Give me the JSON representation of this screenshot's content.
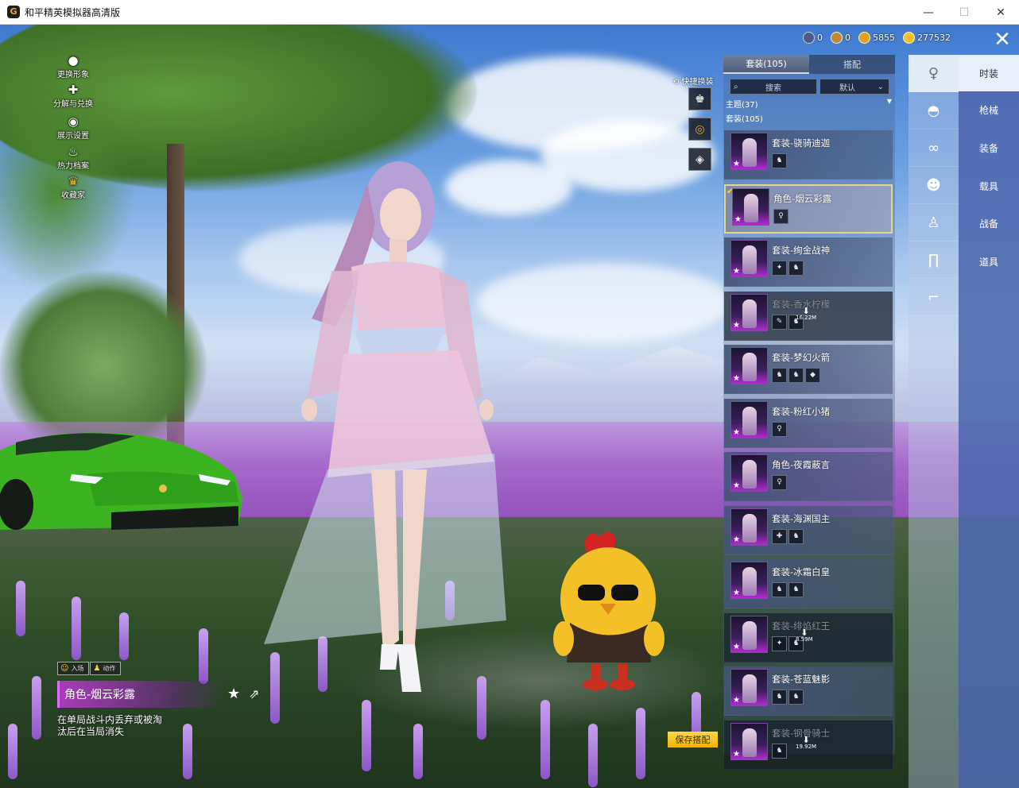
{
  "window": {
    "title": "和平精英模拟器高清版",
    "app_icon": "G",
    "minimize": "—",
    "maximize": "☐",
    "close": "✕"
  },
  "left_menu": [
    {
      "label": "更换形象",
      "icon": "person-icon"
    },
    {
      "label": "分解与兑换",
      "icon": "puzzle-icon"
    },
    {
      "label": "展示设置",
      "icon": "eye-icon"
    },
    {
      "label": "热力档案",
      "icon": "flame-icon"
    },
    {
      "label": "收藏家",
      "icon": "collector-badge-icon"
    }
  ],
  "currency": [
    {
      "name": "gem",
      "value": "0",
      "color": "#4a5a8a"
    },
    {
      "name": "token",
      "value": "0",
      "color": "#c08a30"
    },
    {
      "name": "coupon",
      "value": "5855",
      "color": "#e0a020"
    },
    {
      "name": "coin",
      "value": "277532",
      "color": "#f2c230"
    }
  ],
  "quick_change": {
    "label": "快捷换装"
  },
  "panel": {
    "tabs": [
      "套装(105)",
      "搭配"
    ],
    "search_placeholder": "搜索",
    "sort_value": "默认",
    "theme_label": "主题(37)",
    "set_label": "套装(105)"
  },
  "items": [
    {
      "name": "套装-骁骑迪迦",
      "minis": [
        "♞"
      ],
      "selected": false,
      "download": ""
    },
    {
      "name": "角色-烟云彩露",
      "minis": [
        "♀"
      ],
      "selected": true,
      "download": ""
    },
    {
      "name": "套装-绚金战神",
      "minis": [
        "✦",
        "♞"
      ],
      "selected": false,
      "download": ""
    },
    {
      "name": "套装-香水柠檬",
      "minis": [
        "✎",
        "♞"
      ],
      "selected": false,
      "download": "16.22M"
    },
    {
      "name": "套装-梦幻火箭",
      "minis": [
        "♞",
        "♞",
        "◆"
      ],
      "selected": false,
      "download": ""
    },
    {
      "name": "套装-粉红小猪",
      "minis": [
        "♀"
      ],
      "selected": false,
      "download": ""
    },
    {
      "name": "角色-夜霞蔽言",
      "minis": [
        "♀"
      ],
      "selected": false,
      "download": ""
    },
    {
      "name": "套装-海渊国主",
      "minis": [
        "✚",
        "♞"
      ],
      "selected": false,
      "download": ""
    },
    {
      "name": "套装-冰霜白皇",
      "minis": [
        "♞",
        "♞"
      ],
      "selected": false,
      "download": ""
    },
    {
      "name": "套装-绯焰红王",
      "minis": [
        "✦",
        "♞"
      ],
      "selected": false,
      "download": "8.59M"
    },
    {
      "name": "套装-苍蓝魅影",
      "minis": [
        "♞",
        "♞"
      ],
      "selected": false,
      "download": ""
    },
    {
      "name": "套装-钢骨骑士",
      "minis": [
        "♞"
      ],
      "selected": false,
      "download": "19.92M"
    }
  ],
  "categories": [
    "hanger-icon",
    "cap-icon",
    "goggles-icon",
    "mask-icon",
    "outfit-icon",
    "pants-icon",
    "shoes-icon"
  ],
  "nav": [
    "时装",
    "枪械",
    "装备",
    "载具",
    "战备",
    "道具"
  ],
  "character": {
    "enter_label": "入场",
    "action_label": "动作",
    "name": "角色-烟云彩露",
    "desc": "在单局战斗内丢弃或被淘汰后在当局消失"
  },
  "save_button": "保存搭配",
  "colors": {
    "accent_gold": "#f2c230",
    "selected_border": "#e8d58a",
    "nav_blue": "#5069af",
    "rarity_purple": "#b02bd0"
  }
}
